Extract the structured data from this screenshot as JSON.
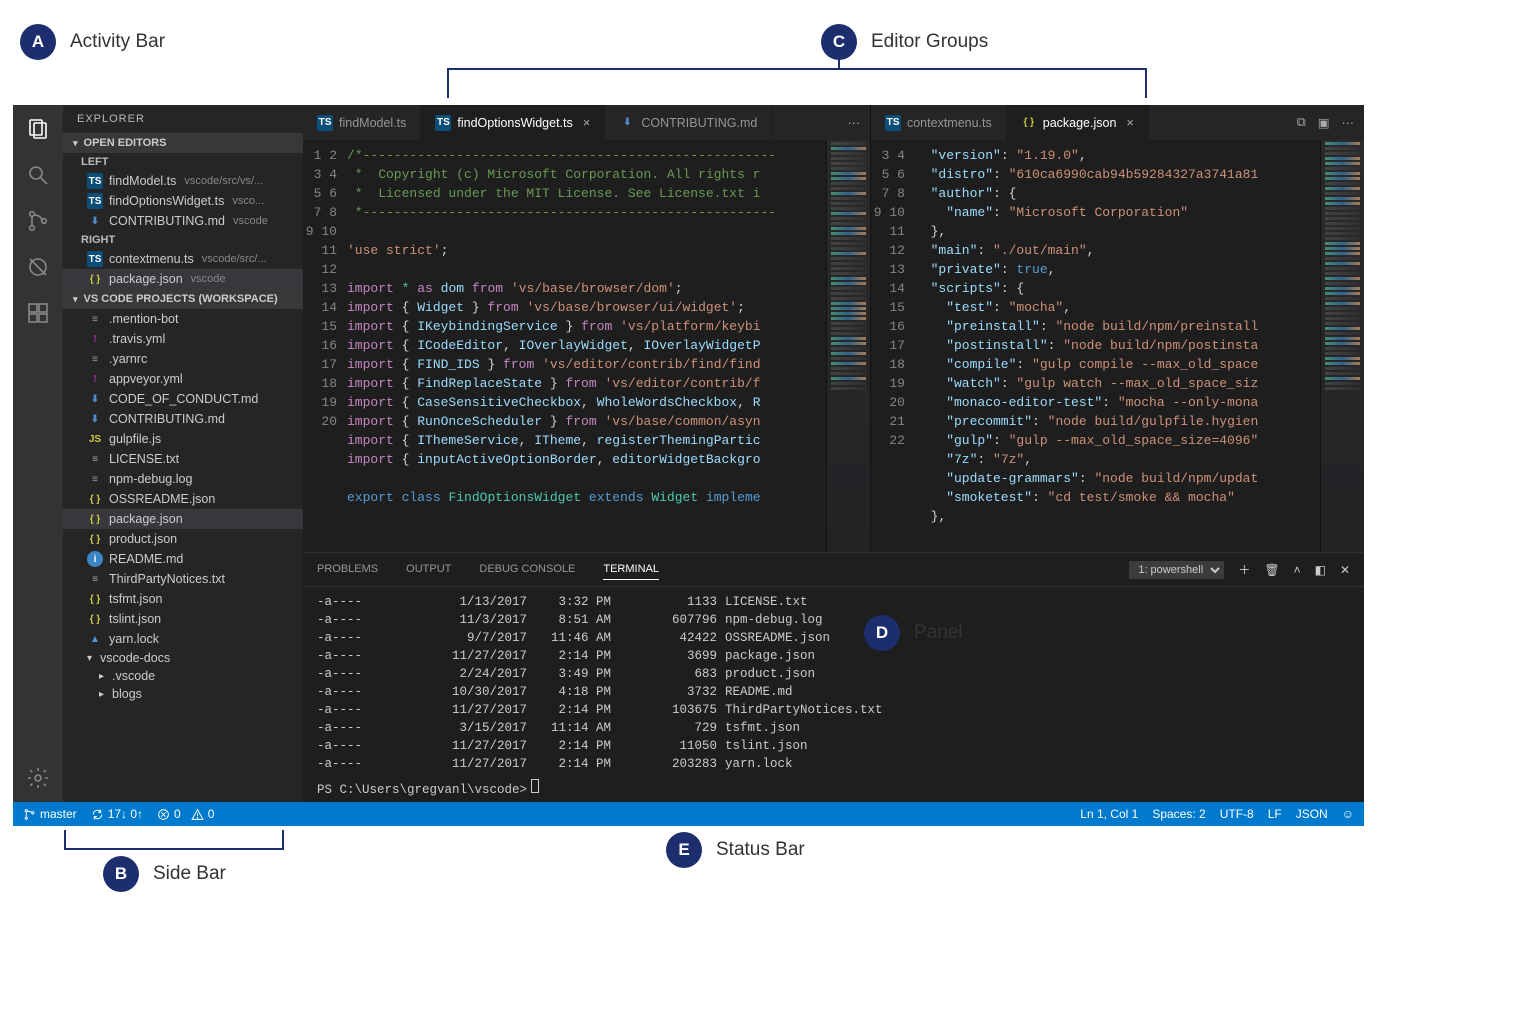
{
  "callouts": {
    "A": "Activity Bar",
    "B": "Side Bar",
    "C": "Editor Groups",
    "D": "Panel",
    "E": "Status Bar"
  },
  "sidebar": {
    "title": "EXPLORER",
    "openEditorsHeader": "OPEN EDITORS",
    "leftLabel": "LEFT",
    "rightLabel": "RIGHT",
    "workspaceHeader": "VS CODE PROJECTS (WORKSPACE)",
    "openEditorsLeft": [
      {
        "icon": "ts",
        "name": "findModel.ts",
        "hint": "vscode/src/vs/..."
      },
      {
        "icon": "ts",
        "name": "findOptionsWidget.ts",
        "hint": "vsco..."
      },
      {
        "icon": "md",
        "name": "CONTRIBUTING.md",
        "hint": "vscode"
      }
    ],
    "openEditorsRight": [
      {
        "icon": "ts",
        "name": "contextmenu.ts",
        "hint": "vscode/src/..."
      },
      {
        "icon": "json",
        "name": "package.json",
        "hint": "vscode",
        "selected": true
      }
    ],
    "files": [
      {
        "icon": "generic",
        "name": ".mention-bot"
      },
      {
        "icon": "yml",
        "name": ".travis.yml"
      },
      {
        "icon": "generic",
        "name": ".yarnrc"
      },
      {
        "icon": "yml",
        "name": "appveyor.yml"
      },
      {
        "icon": "md",
        "name": "CODE_OF_CONDUCT.md"
      },
      {
        "icon": "md",
        "name": "CONTRIBUTING.md"
      },
      {
        "icon": "js",
        "name": "gulpfile.js"
      },
      {
        "icon": "txt",
        "name": "LICENSE.txt"
      },
      {
        "icon": "generic",
        "name": "npm-debug.log"
      },
      {
        "icon": "json",
        "name": "OSSREADME.json"
      },
      {
        "icon": "json",
        "name": "package.json",
        "selected": true
      },
      {
        "icon": "json",
        "name": "product.json"
      },
      {
        "icon": "info",
        "name": "README.md"
      },
      {
        "icon": "txt",
        "name": "ThirdPartyNotices.txt"
      },
      {
        "icon": "json",
        "name": "tsfmt.json"
      },
      {
        "icon": "json",
        "name": "tslint.json"
      },
      {
        "icon": "lock",
        "name": "yarn.lock"
      }
    ],
    "folders": [
      {
        "name": "vscode-docs",
        "expanded": true
      },
      {
        "name": ".vscode",
        "expanded": false,
        "indent": true
      },
      {
        "name": "blogs",
        "expanded": false,
        "indent": true
      }
    ]
  },
  "editorGroups": {
    "left": {
      "tabs": [
        {
          "icon": "ts",
          "label": "findModel.ts",
          "active": false
        },
        {
          "icon": "ts",
          "label": "findOptionsWidget.ts",
          "active": true,
          "close": true
        },
        {
          "icon": "md",
          "label": "CONTRIBUTING.md",
          "active": false
        }
      ],
      "moreLabel": "···",
      "startLine": 1,
      "lines": [
        {
          "html": "<span class='tok-comment'>/*-----------------------------------------------------</span>"
        },
        {
          "html": "<span class='tok-comment'> *  Copyright (c) Microsoft Corporation. All rights r</span>"
        },
        {
          "html": "<span class='tok-comment'> *  Licensed under the MIT License. See License.txt i</span>"
        },
        {
          "html": "<span class='tok-comment'> *-----------------------------------------------------</span>"
        },
        {
          "html": ""
        },
        {
          "html": "<span class='tok-string'>'use strict'</span>;"
        },
        {
          "html": ""
        },
        {
          "html": "<span class='tok-kw'>import</span> <span class='tok-star'>*</span> <span class='tok-kw'>as</span> <span class='tok-id'>dom</span> <span class='tok-kw'>from</span> <span class='tok-string'>'vs/base/browser/dom'</span>;"
        },
        {
          "html": "<span class='tok-kw'>import</span> { <span class='tok-id'>Widget</span> } <span class='tok-kw'>from</span> <span class='tok-string'>'vs/base/browser/ui/widget'</span>;"
        },
        {
          "html": "<span class='tok-kw'>import</span> { <span class='tok-id'>IKeybindingService</span> } <span class='tok-kw'>from</span> <span class='tok-string'>'vs/platform/keybi</span>"
        },
        {
          "html": "<span class='tok-kw'>import</span> { <span class='tok-id'>ICodeEditor</span>, <span class='tok-id'>IOverlayWidget</span>, <span class='tok-id'>IOverlayWidgetP</span>"
        },
        {
          "html": "<span class='tok-kw'>import</span> { <span class='tok-id'>FIND_IDS</span> } <span class='tok-kw'>from</span> <span class='tok-string'>'vs/editor/contrib/find/find</span>"
        },
        {
          "html": "<span class='tok-kw'>import</span> { <span class='tok-id'>FindReplaceState</span> } <span class='tok-kw'>from</span> <span class='tok-string'>'vs/editor/contrib/f</span>"
        },
        {
          "html": "<span class='tok-kw'>import</span> { <span class='tok-id'>CaseSensitiveCheckbox</span>, <span class='tok-id'>WholeWordsCheckbox</span>, <span class='tok-id'>R</span>"
        },
        {
          "html": "<span class='tok-kw'>import</span> { <span class='tok-id'>RunOnceScheduler</span> } <span class='tok-kw'>from</span> <span class='tok-string'>'vs/base/common/asyn</span>"
        },
        {
          "html": "<span class='tok-kw'>import</span> { <span class='tok-id'>IThemeService</span>, <span class='tok-id'>ITheme</span>, <span class='tok-id'>registerThemingPartic</span>"
        },
        {
          "html": "<span class='tok-kw'>import</span> { <span class='tok-id'>inputActiveOptionBorder</span>, <span class='tok-id'>editorWidgetBackgro</span>"
        },
        {
          "html": ""
        },
        {
          "html": "<span class='tok-key'>export</span> <span class='tok-key'>class</span> <span class='tok-type'>FindOptionsWidget</span> <span class='tok-key'>extends</span> <span class='tok-type'>Widget</span> <span class='tok-key'>impleme</span>"
        },
        {
          "html": ""
        }
      ]
    },
    "right": {
      "tabs": [
        {
          "icon": "ts",
          "label": "contextmenu.ts",
          "active": false
        },
        {
          "icon": "json",
          "label": "package.json",
          "active": true,
          "close": true
        }
      ],
      "actions": {
        "compare": "⧉",
        "split": "▣",
        "more": "···"
      },
      "startLine": 3,
      "lines": [
        {
          "html": "  <span class='tok-prop'>\"version\"</span>: <span class='tok-string'>\"1.19.0\"</span>,"
        },
        {
          "html": "  <span class='tok-prop'>\"distro\"</span>: <span class='tok-string'>\"610ca6990cab94b59284327a3741a81</span>"
        },
        {
          "html": "  <span class='tok-prop'>\"author\"</span>: {"
        },
        {
          "html": "    <span class='tok-prop'>\"name\"</span>: <span class='tok-string'>\"Microsoft Corporation\"</span>"
        },
        {
          "html": "  },"
        },
        {
          "html": "  <span class='tok-prop'>\"main\"</span>: <span class='tok-string'>\"./out/main\"</span>,"
        },
        {
          "html": "  <span class='tok-prop'>\"private\"</span>: <span class='tok-bool'>true</span>,"
        },
        {
          "html": "  <span class='tok-prop'>\"scripts\"</span>: {"
        },
        {
          "html": "    <span class='tok-prop'>\"test\"</span>: <span class='tok-string'>\"mocha\"</span>,"
        },
        {
          "html": "    <span class='tok-prop'>\"preinstall\"</span>: <span class='tok-string'>\"node build/npm/preinstall</span>"
        },
        {
          "html": "    <span class='tok-prop'>\"postinstall\"</span>: <span class='tok-string'>\"node build/npm/postinsta</span>"
        },
        {
          "html": "    <span class='tok-prop'>\"compile\"</span>: <span class='tok-string'>\"gulp compile --max_old_space</span>"
        },
        {
          "html": "    <span class='tok-prop'>\"watch\"</span>: <span class='tok-string'>\"gulp watch --max_old_space_siz</span>"
        },
        {
          "html": "    <span class='tok-prop'>\"monaco-editor-test\"</span>: <span class='tok-string'>\"mocha --only-mona</span>"
        },
        {
          "html": "    <span class='tok-prop'>\"precommit\"</span>: <span class='tok-string'>\"node build/gulpfile.hygien</span>"
        },
        {
          "html": "    <span class='tok-prop'>\"gulp\"</span>: <span class='tok-string'>\"gulp --max_old_space_size=4096\"</span>"
        },
        {
          "html": "    <span class='tok-prop'>\"7z\"</span>: <span class='tok-string'>\"7z\"</span>,"
        },
        {
          "html": "    <span class='tok-prop'>\"update-grammars\"</span>: <span class='tok-string'>\"node build/npm/updat</span>"
        },
        {
          "html": "    <span class='tok-prop'>\"smoketest\"</span>: <span class='tok-string'>\"cd test/smoke && mocha\"</span>"
        },
        {
          "html": "  },"
        }
      ]
    }
  },
  "panel": {
    "tabs": [
      "PROBLEMS",
      "OUTPUT",
      "DEBUG CONSOLE",
      "TERMINAL"
    ],
    "activeTab": "TERMINAL",
    "terminalSelector": "1: powershell",
    "rows": [
      {
        "mode": "-a----",
        "date": "1/13/2017",
        "time": "3:32 PM",
        "size": "1133",
        "name": "LICENSE.txt"
      },
      {
        "mode": "-a----",
        "date": "11/3/2017",
        "time": "8:51 AM",
        "size": "607796",
        "name": "npm-debug.log"
      },
      {
        "mode": "-a----",
        "date": "9/7/2017",
        "time": "11:46 AM",
        "size": "42422",
        "name": "OSSREADME.json"
      },
      {
        "mode": "-a----",
        "date": "11/27/2017",
        "time": "2:14 PM",
        "size": "3699",
        "name": "package.json"
      },
      {
        "mode": "-a----",
        "date": "2/24/2017",
        "time": "3:49 PM",
        "size": "683",
        "name": "product.json"
      },
      {
        "mode": "-a----",
        "date": "10/30/2017",
        "time": "4:18 PM",
        "size": "3732",
        "name": "README.md"
      },
      {
        "mode": "-a----",
        "date": "11/27/2017",
        "time": "2:14 PM",
        "size": "103675",
        "name": "ThirdPartyNotices.txt"
      },
      {
        "mode": "-a----",
        "date": "3/15/2017",
        "time": "11:14 AM",
        "size": "729",
        "name": "tsfmt.json"
      },
      {
        "mode": "-a----",
        "date": "11/27/2017",
        "time": "2:14 PM",
        "size": "11050",
        "name": "tslint.json"
      },
      {
        "mode": "-a----",
        "date": "11/27/2017",
        "time": "2:14 PM",
        "size": "203283",
        "name": "yarn.lock"
      }
    ],
    "prompt": "PS C:\\Users\\gregvanl\\vscode>"
  },
  "status": {
    "branch": "master",
    "sync": "17↓ 0↑",
    "errors": "0",
    "warnings": "0",
    "lncol": "Ln 1, Col 1",
    "spaces": "Spaces: 2",
    "encoding": "UTF-8",
    "eol": "LF",
    "lang": "JSON"
  }
}
